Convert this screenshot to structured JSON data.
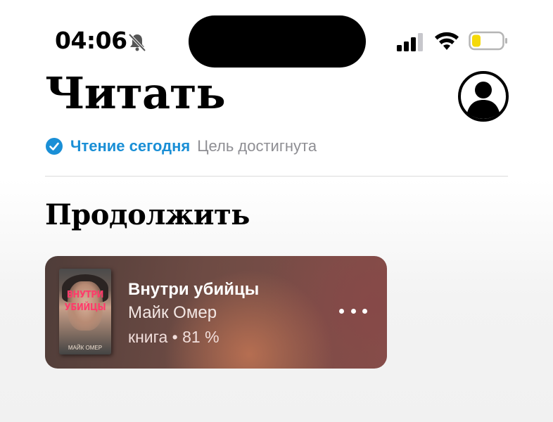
{
  "status_bar": {
    "time": "04:06",
    "icons": [
      "bell-slash-icon",
      "cellular-signal-icon",
      "wifi-icon",
      "battery-low-icon"
    ],
    "battery_color": "#f5d90a"
  },
  "header": {
    "title": "Читать",
    "profile_icon": "person-circle-icon"
  },
  "reading_goal": {
    "icon": "checkmark-circle-icon",
    "label": "Чтение сегодня",
    "status": "Цель достигнута",
    "accent_color": "#1a8fd6"
  },
  "continue_section": {
    "title": "Продолжить",
    "book": {
      "title": "Внутри убийцы",
      "author": "Майк Омер",
      "progress_text": "книга • 81 %",
      "progress_percent": 81,
      "cover": {
        "title_line1": "ВНУТРИ",
        "title_line2": "УБИЙЦЫ",
        "author": "МАЙК ОМЕР"
      },
      "more_icon": "ellipsis-icon"
    }
  }
}
